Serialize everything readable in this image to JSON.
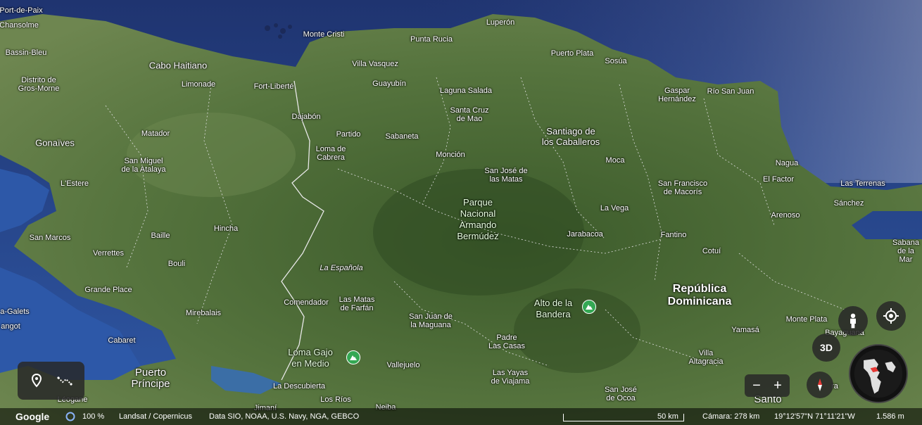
{
  "map_labels": {
    "fort_de_paix": "Port-de-Paix",
    "chansolme": "Chansolme",
    "monte_cristi": "Monte Cristi",
    "luperon": "Luperón",
    "punta_rucia": "Punta Rucia",
    "bassin_bleu": "Bassin-Bleu",
    "cabo_haitiano": "Cabo Haitiano",
    "villa_vasquez": "Villa Vasquez",
    "puerto_plata": "Puerto Plata",
    "sosua": "Sosúa",
    "distrito_gros_morne": "Distrito de\nGros-Morne",
    "limonade": "Limonade",
    "fort_liberte": "Fort-Liberté",
    "guayubin": "Guayubín",
    "laguna_salada": "Laguna Salada",
    "gaspar_hernandez": "Gaspar\nHernández",
    "rio_san_juan": "Río San Juan",
    "dajabon": "Dajabón",
    "santa_cruz_mao": "Santa Cruz\nde Mao",
    "matador": "Matador",
    "partido": "Partido",
    "sabaneta": "Sabaneta",
    "santiago": "Santiago de\nlos Caballeros",
    "gonaives": "Gonaïves",
    "loma_cabrera": "Loma de\nCabrera",
    "moncion": "Monción",
    "san_miguel_atalaya": "San Miguel\nde la Atalaya",
    "moca": "Moca",
    "nagua": "Nagua",
    "san_jose_matas": "San José de\nlas Matas",
    "l_estere": "L'Estere",
    "san_francisco_macoris": "San Francisco\nde Macorís",
    "el_factor": "El Factor",
    "las_terrenas": "Las Terrenas",
    "parque_nacional": "Parque\nNacional\nArmando\nBermúdez",
    "sanchez": "Sánchez",
    "la_vega": "La Vega",
    "arenoso": "Arenoso",
    "hincha": "Hincha",
    "san_marcos": "San Marcos",
    "baille": "Baille",
    "jarabacoa": "Jarabacoa",
    "fantino": "Fantino",
    "sabana_mar": "Sabana\nde la Mar",
    "cotui": "Cotuí",
    "verrettes": "Verrettes",
    "bouli": "Bouli",
    "la_espanola": "La Española",
    "grande_place": "Grande Place",
    "republica_dominicana": "República\nDominicana",
    "comendador": "Comendador",
    "las_matas_farfan": "Las Matas\nde Farfán",
    "alto_bandera": "Alto de la\nBandera",
    "petit_goave_galets": "a-Galets",
    "mirebalais": "Mirebalais",
    "san_juan_maguana": "San Juan de\nla Maguana",
    "monte_plata": "Monte Plata",
    "bayaguana": "Bayaguana",
    "yamasa": "Yamasá",
    "angot": "angot",
    "padre_las_casas": "Padre\nLas Casas",
    "cabaret": "Cabaret",
    "loma_gajo": "Loma Gajo\nen Medio",
    "villa_altagracia": "Villa\nAltagracia",
    "vallejuelo": "Vallejuelo",
    "puerto_principe": "Puerto\nPríncipe",
    "las_yayas": "Las Yayas\nde Viajama",
    "la_descubierta": "La Descubierta",
    "san_jose_ocoa": "San José\nde Ocoa",
    "leogane": "Léogane",
    "los_rios": "Los Ríos",
    "jimani": "Jimaní",
    "neiba": "Neiba",
    "santo": "Santo",
    "yamasa_extra": "ra"
  },
  "controls": {
    "three_d_label": "3D",
    "zoom_out": "−",
    "zoom_in": "+"
  },
  "bottom_bar": {
    "logo": "Google",
    "loading_percent": "100 %",
    "imagery_credit": "Landsat / Copernicus",
    "data_credit": "Data SIO, NOAA, U.S. Navy, NGA, GEBCO",
    "scale_label": "50 km",
    "camera": "Cámara: 278 km",
    "coords": "19°12'57\"N 71°11'21\"W",
    "elevation": "1.586 m"
  },
  "colors": {
    "ocean": "#2b4b8a",
    "land": "#4a6b36",
    "peak_marker": "#34a853",
    "compass_red": "#e53935"
  }
}
